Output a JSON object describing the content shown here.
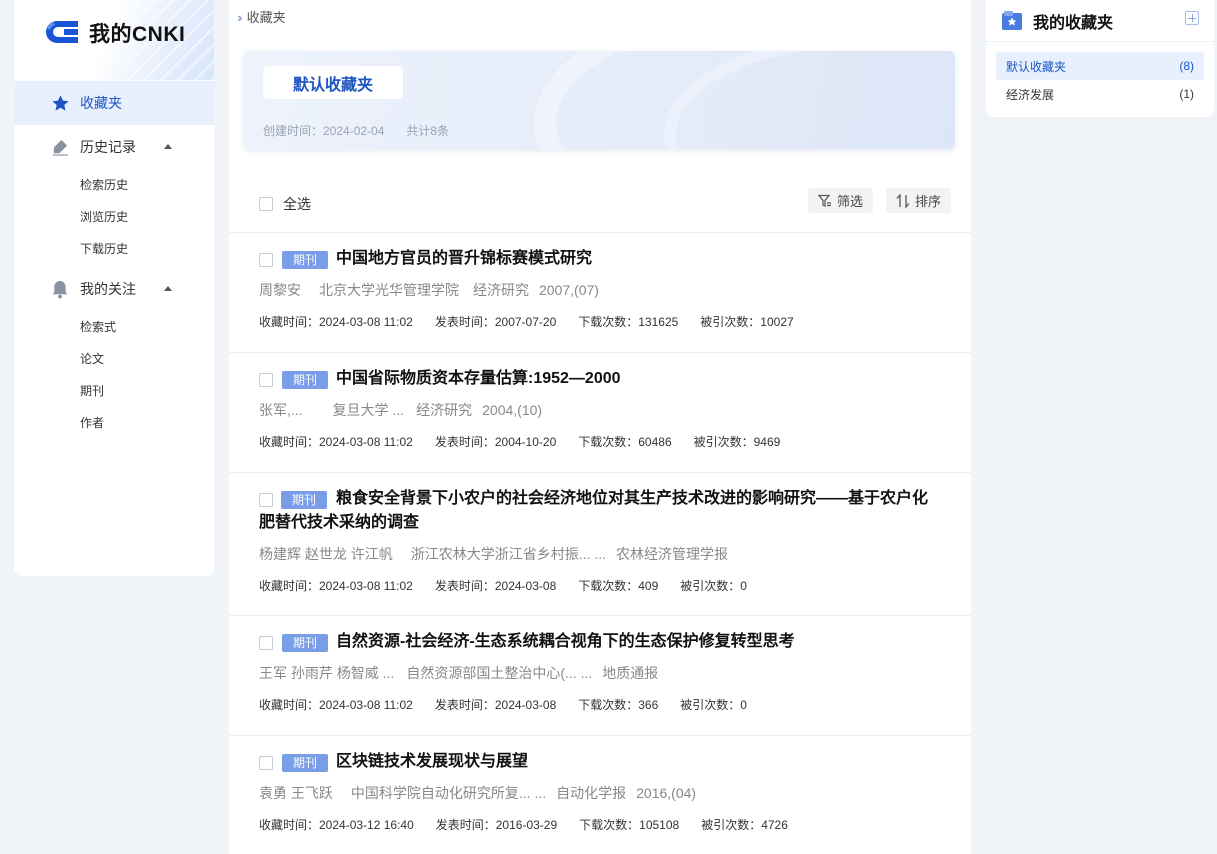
{
  "logo": {
    "text": "我的CNKI"
  },
  "sidebar": {
    "favorites_label": "收藏夹",
    "history": {
      "label": "历史记录",
      "items": [
        "检索历史",
        "浏览历史",
        "下载历史"
      ]
    },
    "follow": {
      "label": "我的关注",
      "items": [
        "检索式",
        "论文",
        "期刊",
        "作者"
      ]
    }
  },
  "breadcrumb": {
    "current": "收藏夹"
  },
  "folder": {
    "name": "默认收藏夹",
    "created": "创建时间：2024-02-04",
    "count": "共计8条"
  },
  "toolbar": {
    "select_all": "全选",
    "filter": "筛选",
    "sort": "排序"
  },
  "items": [
    {
      "tag": "期刊",
      "title": "中国地方官员的晋升锦标赛模式研究",
      "authors": "周黎安",
      "org": "北京大学光华管理学院",
      "source": "经济研究",
      "issue": "2007,(07)",
      "fav": "收藏时间：2024-03-08 11:02",
      "pub": "发表时间：2007-07-20",
      "dl": "下载次数：131625",
      "cite": "被引次数：10027"
    },
    {
      "tag": "期刊",
      "title": "中国省际物质资本存量估算:1952—2000",
      "authors": "张军,...",
      "org": "复旦大学 ...",
      "source": "经济研究",
      "issue": "2004,(10)",
      "fav": "收藏时间：2024-03-08 11:02",
      "pub": "发表时间：2004-10-20",
      "dl": "下载次数：60486",
      "cite": "被引次数：9469"
    },
    {
      "tag": "期刊",
      "title": "粮食安全背景下小农户的社会经济地位对其生产技术改进的影响研究——基于农户化肥替代技术采纳的调查",
      "authors": "杨建辉 赵世龙 许江帆",
      "org": "浙江农林大学浙江省乡村振... ...",
      "source": "农林经济管理学报",
      "issue": "",
      "fav": "收藏时间：2024-03-08 11:02",
      "pub": "发表时间：2024-03-08",
      "dl": "下载次数：409",
      "cite": "被引次数：0"
    },
    {
      "tag": "期刊",
      "title": "自然资源-社会经济-生态系统耦合视角下的生态保护修复转型思考",
      "authors": "王军 孙雨芹 杨智威 ...",
      "org": "自然资源部国土整治中心(... ...",
      "source": "地质通报",
      "issue": "",
      "fav": "收藏时间：2024-03-08 11:02",
      "pub": "发表时间：2024-03-08",
      "dl": "下载次数：366",
      "cite": "被引次数：0"
    },
    {
      "tag": "期刊",
      "title": "区块链技术发展现状与展望",
      "authors": "袁勇 王飞跃",
      "org": "中国科学院自动化研究所复... ...",
      "source": "自动化学报",
      "issue": "2016,(04)",
      "fav": "收藏时间：2024-03-12 16:40",
      "pub": "发表时间：2016-03-29",
      "dl": "下载次数：105108",
      "cite": "被引次数：4726"
    }
  ],
  "right_panel": {
    "title": "我的收藏夹",
    "folders": [
      {
        "name": "默认收藏夹",
        "count": "(8)"
      },
      {
        "name": "经济发展",
        "count": "(1)"
      }
    ]
  },
  "icons": {
    "favorites": "star-icon",
    "history": "eraser-icon",
    "follow": "bell-icon",
    "filter": "funnel-icon",
    "sort": "sort-arrows-icon",
    "add": "plus-square-icon"
  },
  "colors": {
    "accent": "#1d55c4",
    "tag": "#7a9de8"
  }
}
